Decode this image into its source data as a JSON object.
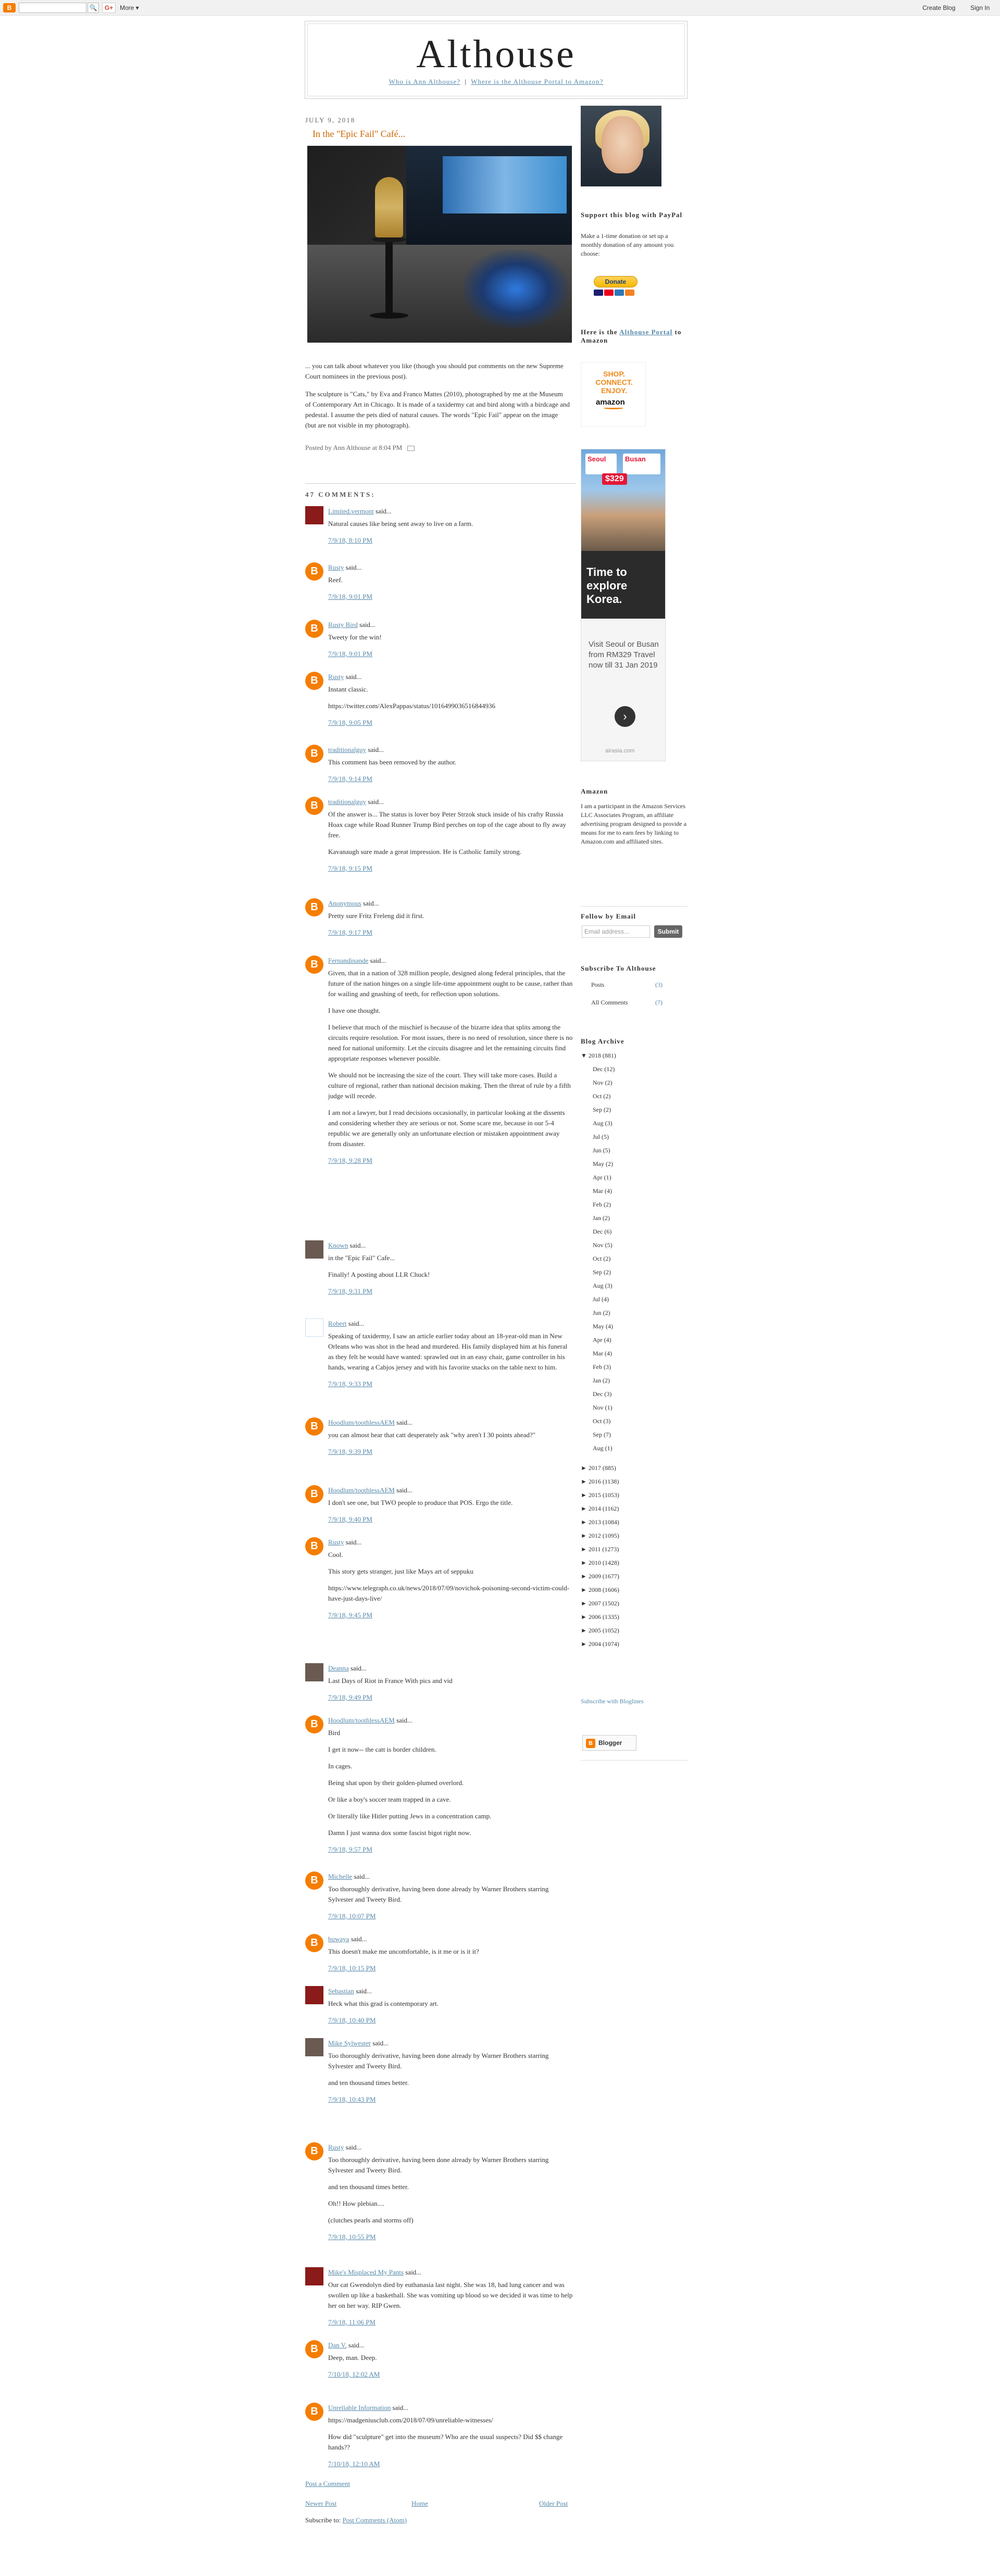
{
  "navbar": {
    "search_button": "🔍",
    "gplus": "G+",
    "more": "More ▾",
    "create_blog": "Create Blog",
    "sign_in": "Sign In"
  },
  "header": {
    "title": "Althouse",
    "link_ann": "Who is Ann Althouse?",
    "link_portal": "Where is the Althouse Portal to Amazon?"
  },
  "post": {
    "date": "JULY 9, 2018",
    "title": "In the \"Epic Fail\" Café...",
    "body": [
      "... you can talk about whatever you like (though you should put comments on the new Supreme Court nominees in the previous post).",
      "The sculpture is \"Cats,\" by Eva and Franco Mattes (2010), photographed by me at the Museum of Contemporary Art in Chicago. It is made of a taxidermy cat and bird along with a birdcage and pedestal. I assume the pets died of natural causes. The words \"Epic Fail\" appear on the image (but are not visible in my photograph)."
    ],
    "footer": "Posted by Ann Althouse at 8:04 PM",
    "comments_header": "47 COMMENTS:"
  },
  "comments": [
    {
      "avatar": "",
      "author": "Limited.vermont",
      "body": [
        "Natural causes like being sent away to live on a farm."
      ],
      "date": "7/9/18, 8:10 PM"
    },
    {
      "avatar": "B",
      "author": "Rusty",
      "body": [
        "Reef."
      ],
      "date": "7/9/18, 9:01 PM"
    },
    {
      "avatar": "B",
      "author": "Rusty Bird",
      "body": [
        "Tweety for the win!"
      ],
      "date": "7/9/18, 9:01 PM"
    },
    {
      "avatar": "B",
      "author": "Rusty",
      "body": [
        "Instant classic.",
        "https://twitter.com/AlexPappas/status/1016499036516844936"
      ],
      "date": "7/9/18, 9:05 PM"
    },
    {
      "avatar": "B",
      "author": "traditionalguy",
      "body": [
        "This comment has been removed by the author."
      ],
      "date": "7/9/18, 9:14 PM"
    },
    {
      "avatar": "B",
      "author": "traditionalguy",
      "body": [
        "Of the answer is... The status is lover boy Peter Strzok stuck inside of his crafty Russia Hoax cage while Road Runner Trump Bird perches on top of the cage about to fly away free.",
        "Kavanaugh sure made a great impression. He is Catholic family strong."
      ],
      "date": "7/9/18, 9:15 PM"
    },
    {
      "avatar": "B",
      "author": "Anonymous",
      "body": [
        "Pretty sure Fritz Freleng did it first."
      ],
      "date": "7/9/18, 9:17 PM"
    },
    {
      "avatar": "B",
      "author": "Fernandinande",
      "body": [
        "Given, that in a nation of 328 million people, designed along federal principles, that the future of the nation hinges on a single life-time appointment ought to be cause, rather than for wailing and gnashing of teeth, for reflection upon solutions.",
        "I have one thought.",
        "I believe that much of the mischief is because of the bizarre idea that splits among the circuits require resolution. For most issues, there is no need of resolution, since there is no need for national uniformity. Let the circuits disagree and let the remaining circuits find appropriate responses whenever possible.",
        "We should not be increasing the size of the court. They will take more cases. Build a culture of regional, rather than national decision making. Then the threat of rule by a fifth judge will recede.",
        "I am not a lawyer, but I read decisions occasionally, in particular looking at the dissents and considering whether they are serious or not. Some scare me, because in our 5-4 republic we are generally only an unfortunate election or mistaken appointment away from disaster."
      ],
      "date": "7/9/18, 9:28 PM"
    },
    {
      "avatar": "",
      "author": "Known",
      "body": [
        "in the \"Epic Fail\" Cafe...",
        "Finally! A posting about LLR Chuck!"
      ],
      "date": "7/9/18, 9:31 PM"
    },
    {
      "avatar": "",
      "author": "Robert",
      "body": [
        "Speaking of taxidermy, I saw an article earlier today about an 18-year-old man in New Orleans who was shot in the head and murdered. His family displayed him at his funeral as they felt he would have wanted: sprawled out in an easy chair, game controller in his hands, wearing a Cabjos jersey and with his favorite snacks on the table next to him."
      ],
      "date": "7/9/18, 9:33 PM"
    },
    {
      "avatar": "B",
      "author": "Hoodlum/toothlessAEM",
      "body": [
        "you can almost hear that catt desperately ask \"why aren't I 30 points ahead?\""
      ],
      "date": "7/9/18, 9:39 PM"
    },
    {
      "avatar": "B",
      "author": "Hoodlum/toothlessAEM",
      "body": [
        "I don't see one, but TWO people to produce that POS. Ergo the title."
      ],
      "date": "7/9/18, 9:40 PM"
    },
    {
      "avatar": "B",
      "author": "Rusty",
      "body": [
        "Cool.",
        "This story gets stranger, just like Mays art of seppuku",
        "https://www.telegraph.co.uk/news/2018/07/09/novichok-poisoning-second-victim-could-have-just-days-live/"
      ],
      "date": "7/9/18, 9:45 PM"
    },
    {
      "avatar": "",
      "author": "Deanna",
      "body": [
        "Last Days of Riot in France With pics and vid"
      ],
      "date": "7/9/18, 9:49 PM"
    },
    {
      "avatar": "B",
      "author": "Hoodlum/toothlessAEM",
      "body": [
        "Bird",
        "I get it now-- the catt is border children.",
        "In cages.",
        "Being shat upon by their golden-plumed overlord.",
        "Or like a boy's soccer team trapped in a cave.",
        "Or literally like Hitler putting Jews in a concentration camp.",
        "Damn I just wanna dox some fascist bigot right now."
      ],
      "date": "7/9/18, 9:57 PM"
    },
    {
      "avatar": "B",
      "author": "Michelle",
      "body": [
        "Too thoroughly derivative, having been done already by Warner Brothers starring Sylvester and Tweety Bird."
      ],
      "date": "7/9/18, 10:07 PM"
    },
    {
      "avatar": "B",
      "author": "buwaya",
      "body": [
        "This doesn't make me uncomfortable, is it me or is it it?"
      ],
      "date": "7/9/18, 10:15 PM"
    },
    {
      "avatar": "",
      "author": "Sebastian",
      "body": [
        "Heck what this grad is contemporary art."
      ],
      "date": "7/9/18, 10:40 PM"
    },
    {
      "avatar": "",
      "author": "Mike Sylwester",
      "body": [
        "Too thoroughly derivative, having been done already by Warner Brothers starring Sylvester and Tweety Bird.",
        "and ten thousand times better."
      ],
      "date": "7/9/18, 10:43 PM"
    },
    {
      "avatar": "B",
      "author": "Rusty",
      "body": [
        "Too thoroughly derivative, having been done already by Warner Brothers starring Sylvester and Tweety Bird.",
        "and ten thousand times better.",
        "Oh!! How plebian....",
        "(clutches pearls and storms off)"
      ],
      "date": "7/9/18, 10:55 PM"
    },
    {
      "avatar": "",
      "author": "Mike's Misplaced My Pants",
      "body": [
        "Our cat Gwendolyn died by euthanasia last night. She was 18, had lung cancer and was swollen up like a basketball. She was vomiting up blood so we decided it was time to help her on her way. RIP Gwen."
      ],
      "date": "7/9/18, 11:06 PM"
    },
    {
      "avatar": "B",
      "author": "Dan V.",
      "body": [
        "Deep, man. Deep."
      ],
      "date": "7/10/18, 12:02 AM"
    },
    {
      "avatar": "B",
      "author": "Unreliable Information",
      "body": [
        "https://madgeniusclub.com/2018/07/09/unreliable-witnesses/",
        "How did \"sculpture\" get into the museum? Who are the usual suspects? Did $$ change hands??"
      ],
      "date": "7/10/18, 12:10 AM"
    }
  ],
  "post_bottom": {
    "post_comment": "Post a Comment",
    "newer": "Newer Post",
    "home": "Home",
    "older": "Older Post",
    "subscribe_label": "Subscribe to:",
    "subscribe_link": "Post Comments (Atom)"
  },
  "sidebar": {
    "support_heading": "Support this blog with PayPal",
    "support_text": "Make a 1-time donation or set up a monthly donation of any amount you choose:",
    "donate": "Donate",
    "portal_heading_pre": "Here is the ",
    "portal_heading_link": "Althouse Portal",
    "portal_heading_post": " to Amazon",
    "shop_text": "SHOP. CONNECT. ENJOY.",
    "shop_brand": "amazon",
    "ad": {
      "balloon1": "Seoul",
      "balloon2": "Busan",
      "price": "$329",
      "dark_text": "Time to explore Korea.",
      "lower_text": "Visit Seoul or Busan from RM329 Travel now till 31 Jan 2019",
      "go": "›",
      "domain": "airasia.com"
    },
    "amazon_heading": "Amazon",
    "amazon_text": "I am a participant in the Amazon Services LLC Associates Program, an affiliate advertising program designed to provide a means for me to earn fees by linking to Amazon.com and affiliated sites.",
    "follow_heading": "Follow by Email",
    "email_placeholder": "Email address...",
    "submit": "Submit",
    "subscribe_heading": "Subscribe To Althouse",
    "subscribe_items": [
      {
        "label": "Posts",
        "count": "(3)"
      },
      {
        "label": "All Comments",
        "count": "(7)"
      }
    ],
    "archive_heading": "Blog Archive",
    "archive_years": [
      {
        "label": "▼ 2018 (881)",
        "months": [
          {
            "label": "▼ 2018 (881)"
          }
        ]
      }
    ],
    "archive_months": [
      "Dec (12)",
      "Nov (2)",
      "Oct (2)",
      "Sep (2)",
      "Aug (3)",
      "Jul (5)",
      "Jun (5)",
      "May (2)",
      "Apr (1)",
      "Mar (4)",
      "Feb (2)",
      "Jan (2)",
      "Dec (6)",
      "Nov (5)",
      "Oct (2)",
      "Sep (2)",
      "Aug (3)",
      "Jul (4)",
      "Jun (2)",
      "May (4)",
      "Apr (4)",
      "Mar (4)",
      "Feb (3)",
      "Jan (2)",
      "Dec (3)",
      "Nov (1)",
      "Oct (3)",
      "Sep (7)",
      "Aug (1)"
    ],
    "archive_year_list": [
      "► 2017 (885)",
      "► 2016 (1138)",
      "► 2015 (1053)",
      "► 2014 (1162)",
      "► 2013 (1084)",
      "► 2012 (1095)",
      "► 2011 (1273)",
      "► 2010 (1428)",
      "► 2009 (1677)",
      "► 2008 (1606)",
      "► 2007 (1502)",
      "► 2006 (1335)",
      "► 2005 (1052)",
      "► 2004 (1074)"
    ],
    "bloglines": "Subscribe with Bloglines",
    "powered_by": "Blogger",
    "powered_icon": "B"
  },
  "colors": {
    "accent": "#cc6600",
    "link": "#5588aa",
    "blogger_orange": "#f57d00"
  }
}
